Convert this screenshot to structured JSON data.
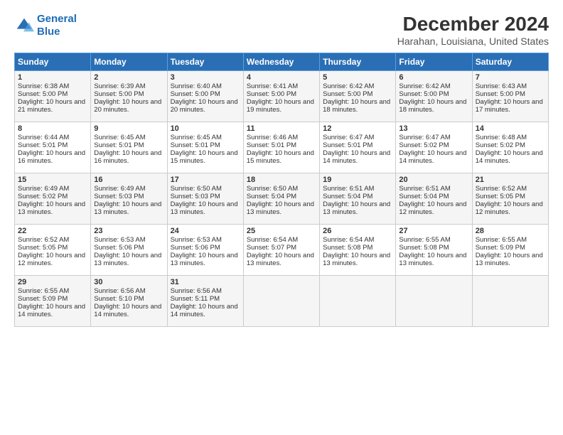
{
  "logo": {
    "line1": "General",
    "line2": "Blue"
  },
  "title": "December 2024",
  "subtitle": "Harahan, Louisiana, United States",
  "days_header": [
    "Sunday",
    "Monday",
    "Tuesday",
    "Wednesday",
    "Thursday",
    "Friday",
    "Saturday"
  ],
  "weeks": [
    [
      {
        "day": "1",
        "rise": "Sunrise: 6:38 AM",
        "set": "Sunset: 5:00 PM",
        "daylight": "Daylight: 10 hours and 21 minutes."
      },
      {
        "day": "2",
        "rise": "Sunrise: 6:39 AM",
        "set": "Sunset: 5:00 PM",
        "daylight": "Daylight: 10 hours and 20 minutes."
      },
      {
        "day": "3",
        "rise": "Sunrise: 6:40 AM",
        "set": "Sunset: 5:00 PM",
        "daylight": "Daylight: 10 hours and 20 minutes."
      },
      {
        "day": "4",
        "rise": "Sunrise: 6:41 AM",
        "set": "Sunset: 5:00 PM",
        "daylight": "Daylight: 10 hours and 19 minutes."
      },
      {
        "day": "5",
        "rise": "Sunrise: 6:42 AM",
        "set": "Sunset: 5:00 PM",
        "daylight": "Daylight: 10 hours and 18 minutes."
      },
      {
        "day": "6",
        "rise": "Sunrise: 6:42 AM",
        "set": "Sunset: 5:00 PM",
        "daylight": "Daylight: 10 hours and 18 minutes."
      },
      {
        "day": "7",
        "rise": "Sunrise: 6:43 AM",
        "set": "Sunset: 5:00 PM",
        "daylight": "Daylight: 10 hours and 17 minutes."
      }
    ],
    [
      {
        "day": "8",
        "rise": "Sunrise: 6:44 AM",
        "set": "Sunset: 5:01 PM",
        "daylight": "Daylight: 10 hours and 16 minutes."
      },
      {
        "day": "9",
        "rise": "Sunrise: 6:45 AM",
        "set": "Sunset: 5:01 PM",
        "daylight": "Daylight: 10 hours and 16 minutes."
      },
      {
        "day": "10",
        "rise": "Sunrise: 6:45 AM",
        "set": "Sunset: 5:01 PM",
        "daylight": "Daylight: 10 hours and 15 minutes."
      },
      {
        "day": "11",
        "rise": "Sunrise: 6:46 AM",
        "set": "Sunset: 5:01 PM",
        "daylight": "Daylight: 10 hours and 15 minutes."
      },
      {
        "day": "12",
        "rise": "Sunrise: 6:47 AM",
        "set": "Sunset: 5:01 PM",
        "daylight": "Daylight: 10 hours and 14 minutes."
      },
      {
        "day": "13",
        "rise": "Sunrise: 6:47 AM",
        "set": "Sunset: 5:02 PM",
        "daylight": "Daylight: 10 hours and 14 minutes."
      },
      {
        "day": "14",
        "rise": "Sunrise: 6:48 AM",
        "set": "Sunset: 5:02 PM",
        "daylight": "Daylight: 10 hours and 14 minutes."
      }
    ],
    [
      {
        "day": "15",
        "rise": "Sunrise: 6:49 AM",
        "set": "Sunset: 5:02 PM",
        "daylight": "Daylight: 10 hours and 13 minutes."
      },
      {
        "day": "16",
        "rise": "Sunrise: 6:49 AM",
        "set": "Sunset: 5:03 PM",
        "daylight": "Daylight: 10 hours and 13 minutes."
      },
      {
        "day": "17",
        "rise": "Sunrise: 6:50 AM",
        "set": "Sunset: 5:03 PM",
        "daylight": "Daylight: 10 hours and 13 minutes."
      },
      {
        "day": "18",
        "rise": "Sunrise: 6:50 AM",
        "set": "Sunset: 5:04 PM",
        "daylight": "Daylight: 10 hours and 13 minutes."
      },
      {
        "day": "19",
        "rise": "Sunrise: 6:51 AM",
        "set": "Sunset: 5:04 PM",
        "daylight": "Daylight: 10 hours and 13 minutes."
      },
      {
        "day": "20",
        "rise": "Sunrise: 6:51 AM",
        "set": "Sunset: 5:04 PM",
        "daylight": "Daylight: 10 hours and 12 minutes."
      },
      {
        "day": "21",
        "rise": "Sunrise: 6:52 AM",
        "set": "Sunset: 5:05 PM",
        "daylight": "Daylight: 10 hours and 12 minutes."
      }
    ],
    [
      {
        "day": "22",
        "rise": "Sunrise: 6:52 AM",
        "set": "Sunset: 5:05 PM",
        "daylight": "Daylight: 10 hours and 12 minutes."
      },
      {
        "day": "23",
        "rise": "Sunrise: 6:53 AM",
        "set": "Sunset: 5:06 PM",
        "daylight": "Daylight: 10 hours and 13 minutes."
      },
      {
        "day": "24",
        "rise": "Sunrise: 6:53 AM",
        "set": "Sunset: 5:06 PM",
        "daylight": "Daylight: 10 hours and 13 minutes."
      },
      {
        "day": "25",
        "rise": "Sunrise: 6:54 AM",
        "set": "Sunset: 5:07 PM",
        "daylight": "Daylight: 10 hours and 13 minutes."
      },
      {
        "day": "26",
        "rise": "Sunrise: 6:54 AM",
        "set": "Sunset: 5:08 PM",
        "daylight": "Daylight: 10 hours and 13 minutes."
      },
      {
        "day": "27",
        "rise": "Sunrise: 6:55 AM",
        "set": "Sunset: 5:08 PM",
        "daylight": "Daylight: 10 hours and 13 minutes."
      },
      {
        "day": "28",
        "rise": "Sunrise: 6:55 AM",
        "set": "Sunset: 5:09 PM",
        "daylight": "Daylight: 10 hours and 13 minutes."
      }
    ],
    [
      {
        "day": "29",
        "rise": "Sunrise: 6:55 AM",
        "set": "Sunset: 5:09 PM",
        "daylight": "Daylight: 10 hours and 14 minutes."
      },
      {
        "day": "30",
        "rise": "Sunrise: 6:56 AM",
        "set": "Sunset: 5:10 PM",
        "daylight": "Daylight: 10 hours and 14 minutes."
      },
      {
        "day": "31",
        "rise": "Sunrise: 6:56 AM",
        "set": "Sunset: 5:11 PM",
        "daylight": "Daylight: 10 hours and 14 minutes."
      },
      null,
      null,
      null,
      null
    ]
  ]
}
